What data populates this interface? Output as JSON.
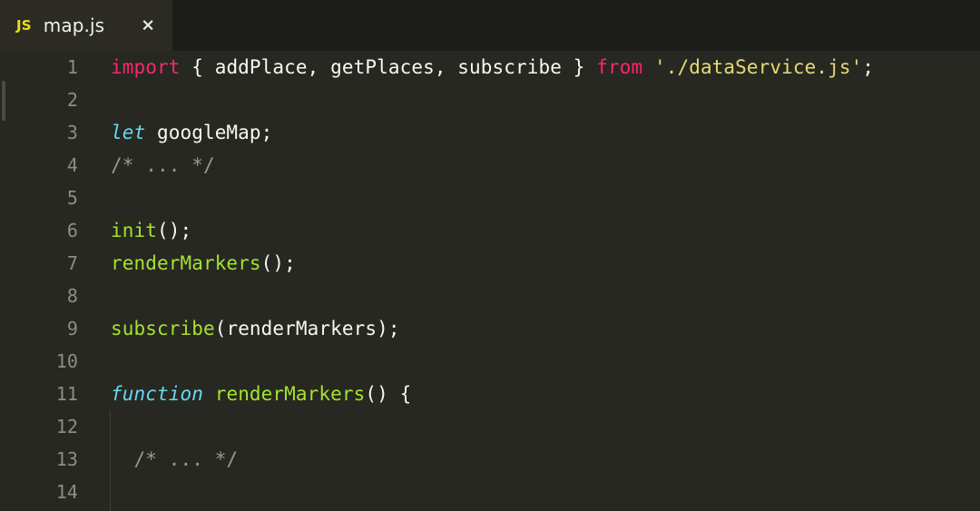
{
  "window": {
    "title": "map.js",
    "theme_background": "#272822"
  },
  "tab_bar": {
    "background": "#1c1c1a",
    "tabs": [
      {
        "icon_label": "JS",
        "icon_color": "#f2dd14",
        "title": "map.js",
        "close_label": "×",
        "active": true
      }
    ]
  },
  "editor": {
    "language": "JavaScript",
    "first_visible_line": 1,
    "last_visible_line": 14,
    "colors": {
      "keyword": "#f92672",
      "storage": "#66d9ef",
      "function": "#a6e22e",
      "string": "#e6db74",
      "comment": "#9a9a86",
      "plain": "#f8f8f2",
      "line_number": "#8d8d83",
      "indent_guide": "#3d3d37",
      "background": "#272822"
    },
    "lines": [
      {
        "number": "1",
        "tokens": [
          {
            "text": "import",
            "type": "key"
          },
          {
            "text": " { addPlace, getPlaces, subscribe } ",
            "type": "plain"
          },
          {
            "text": "from",
            "type": "key"
          },
          {
            "text": " ",
            "type": "plain"
          },
          {
            "text": "'./dataService.js'",
            "type": "str"
          },
          {
            "text": ";",
            "type": "plain"
          }
        ]
      },
      {
        "number": "2",
        "tokens": []
      },
      {
        "number": "3",
        "tokens": [
          {
            "text": "let",
            "type": "storage"
          },
          {
            "text": " googleMap;",
            "type": "plain"
          }
        ]
      },
      {
        "number": "4",
        "tokens": [
          {
            "text": "/* ... */",
            "type": "comment"
          }
        ]
      },
      {
        "number": "5",
        "tokens": []
      },
      {
        "number": "6",
        "tokens": [
          {
            "text": "init",
            "type": "fn"
          },
          {
            "text": "();",
            "type": "plain"
          }
        ]
      },
      {
        "number": "7",
        "tokens": [
          {
            "text": "renderMarkers",
            "type": "fn"
          },
          {
            "text": "();",
            "type": "plain"
          }
        ]
      },
      {
        "number": "8",
        "tokens": []
      },
      {
        "number": "9",
        "tokens": [
          {
            "text": "subscribe",
            "type": "fn"
          },
          {
            "text": "(renderMarkers);",
            "type": "plain"
          }
        ]
      },
      {
        "number": "10",
        "tokens": []
      },
      {
        "number": "11",
        "tokens": [
          {
            "text": "function",
            "type": "storage"
          },
          {
            "text": " ",
            "type": "plain"
          },
          {
            "text": "renderMarkers",
            "type": "fn"
          },
          {
            "text": "() {",
            "type": "plain"
          }
        ]
      },
      {
        "number": "12",
        "tokens": []
      },
      {
        "number": "13",
        "tokens": [
          {
            "text": "  /* ... */",
            "type": "comment"
          }
        ]
      },
      {
        "number": "14",
        "tokens": []
      }
    ]
  }
}
